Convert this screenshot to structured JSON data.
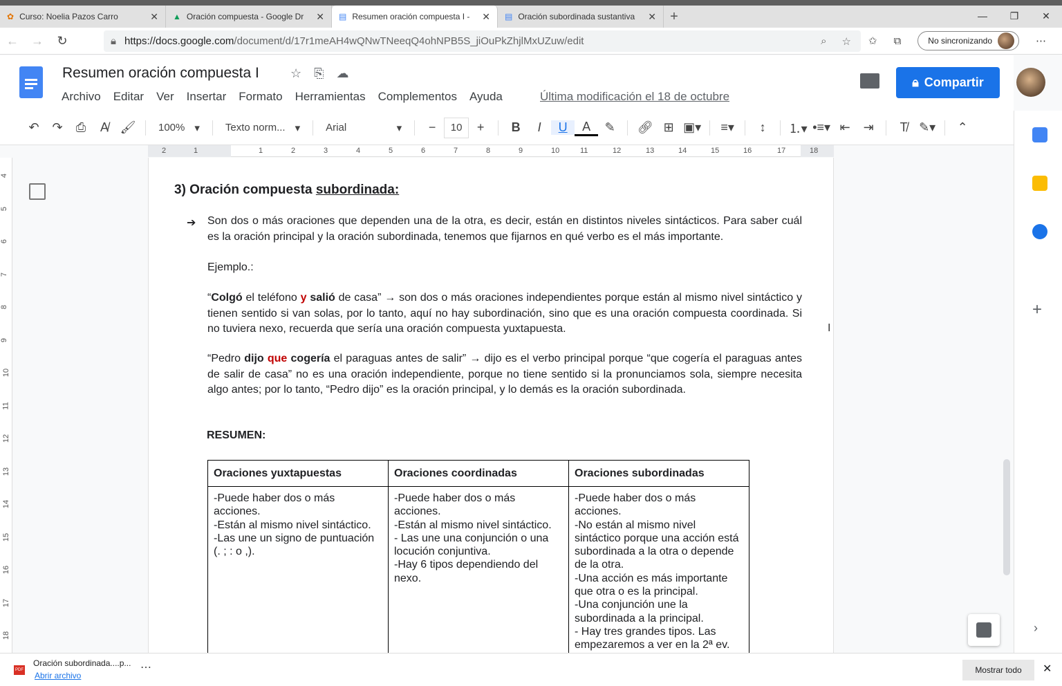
{
  "browser": {
    "tabs": [
      {
        "label": "Curso: Noelia Pazos Carro",
        "icon": "moodle-icon"
      },
      {
        "label": "Oración compuesta - Google Dr",
        "icon": "drive-icon"
      },
      {
        "label": "Resumen oración compuesta I -",
        "icon": "docs-icon",
        "active": true
      },
      {
        "label": "Oración subordinada sustantiva",
        "icon": "docs-icon"
      }
    ],
    "url_host": "https://docs.google.com",
    "url_path": "/document/d/17r1meAH4wQNwTNeeqQ4ohNPB5S_jiOuPkZhjlMxUZuw/edit",
    "sync_label": "No sincronizando"
  },
  "doc": {
    "title": "Resumen oración compuesta I",
    "menus": [
      "Archivo",
      "Editar",
      "Ver",
      "Insertar",
      "Formato",
      "Herramientas",
      "Complementos",
      "Ayuda"
    ],
    "last_modified": "Última modificación el 18 de octubre",
    "share_label": "Compartir"
  },
  "toolbar": {
    "zoom": "100%",
    "style": "Texto norm...",
    "font": "Arial",
    "font_size": "10"
  },
  "ruler": {
    "h": [
      "2",
      "1",
      "1",
      "2",
      "3",
      "4",
      "5",
      "6",
      "7",
      "8",
      "9",
      "10",
      "11",
      "12",
      "13",
      "14",
      "15",
      "16",
      "17",
      "18"
    ],
    "v": [
      "4",
      "5",
      "6",
      "7",
      "8",
      "9",
      "10",
      "11",
      "12",
      "13",
      "14",
      "15",
      "16",
      "17",
      "18"
    ]
  },
  "content": {
    "heading_prefix": "3) Oración compuesta ",
    "heading_underlined": "subordinada:",
    "bullet": "➔",
    "p1": "Son dos o más oraciones que dependen una de la otra, es decir, están en distintos niveles sintácticos. Para saber cuál es la oración principal y la oración subordinada, tenemos que fijarnos en qué verbo es el más importante.",
    "ejemplo": "Ejemplo.:",
    "ex1": [
      {
        "t": "“"
      },
      {
        "t": "Colgó",
        "b": 1
      },
      {
        "t": " el teléfono "
      },
      {
        "t": "y",
        "b": 1,
        "r": 1
      },
      {
        "t": " "
      },
      {
        "t": "salió",
        "b": 1
      },
      {
        "t": " de casa” →  son dos o más oraciones independientes porque están al mismo nivel sintáctico y tienen sentido si van solas, por lo tanto, aquí no hay subordinación, sino que es una oración compuesta coordinada. Si no tuviera nexo, recuerda que sería una oración compuesta yuxtapuesta."
      }
    ],
    "ex2": [
      {
        "t": "“Pedro "
      },
      {
        "t": "dijo",
        "b": 1
      },
      {
        "t": " "
      },
      {
        "t": "que",
        "b": 1,
        "r": 1
      },
      {
        "t": " "
      },
      {
        "t": "cogería",
        "b": 1
      },
      {
        "t": " el paraguas antes de salir” → dijo es el verbo principal porque “que cogería el paraguas antes de salir de casa” no es una oración independiente, porque no tiene sentido si la pronunciamos sola, siempre necesita algo antes; por lo tanto, “Pedro dijo” es la oración principal, y lo demás es la oración subordinada."
      }
    ],
    "resumen": "RESUMEN:",
    "table": {
      "headers": [
        "Oraciones yuxtapuestas",
        "Oraciones coordinadas",
        "Oraciones subordinadas"
      ],
      "cells": [
        [
          "-Puede haber dos o más acciones.",
          "-Están al mismo nivel sintáctico.",
          "-Las une un signo de puntuación (. ; : o ,)."
        ],
        [
          "-Puede haber dos o más acciones.",
          "-Están al mismo nivel sintáctico.",
          "- Las une una conjunción o una locución conjuntiva.",
          "-Hay 6 tipos dependiendo del nexo."
        ],
        [
          "-Puede haber dos o más acciones.",
          "-No están al mismo nivel sintáctico porque una acción está subordinada a la otra o depende de la otra.",
          "-Una acción es más importante que otra o es la principal.",
          "-Una conjunción une la subordinada a la principal.",
          "- Hay tres grandes tipos. Las empezaremos a ver en la 2ª ev."
        ]
      ]
    }
  },
  "download": {
    "file": "Oración subordinada....p...",
    "open": "Abrir archivo",
    "show_all": "Mostrar todo",
    "file_type": "PDF"
  }
}
